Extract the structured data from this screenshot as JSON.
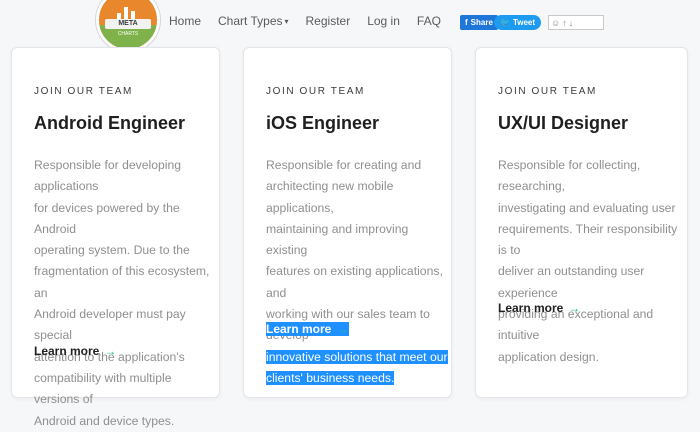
{
  "logo": {
    "text": "META",
    "subtext": "CHARTS"
  },
  "nav": {
    "home": "Home",
    "chart_types": "Chart Types",
    "register": "Register",
    "login": "Log in",
    "faq": "FAQ"
  },
  "social": {
    "share": "Share",
    "tweet": "Tweet"
  },
  "cards": [
    {
      "eyebrow": "JOIN OUR TEAM",
      "title": "Android Engineer",
      "description_lines": [
        "Responsible for developing applications",
        "for devices powered by the Android",
        "operating system. Due to the",
        "fragmentation of this ecosystem, an",
        "Android developer must pay special",
        "attention to the application's",
        "compatibility with multiple versions of",
        "Android and device types."
      ],
      "learn_more": "Learn more"
    },
    {
      "eyebrow": "JOIN OUR TEAM",
      "title": "iOS Engineer",
      "description_lines": [
        "Responsible for creating and",
        "architecting new mobile applications,",
        "maintaining and improving existing",
        "features on existing applications, and",
        "working with our sales team to develop"
      ],
      "description_highlighted_lines": [
        "innovative solutions that meet our",
        "clients' business needs."
      ],
      "learn_more": "Learn more"
    },
    {
      "eyebrow": "JOIN OUR TEAM",
      "title": "UX/UI Designer",
      "description_lines": [
        "Responsible for collecting, researching,",
        "investigating and evaluating user",
        "requirements. Their responsibility is to",
        "deliver an outstanding user experience",
        "providing an exceptional and intuitive",
        "application design."
      ],
      "learn_more": "Learn more"
    }
  ],
  "colors": {
    "accent_arrow": "#1fb8a6",
    "selection": "#1e90ff",
    "share_button": "#1e77d8",
    "tweet_button": "#1d9bf0"
  }
}
